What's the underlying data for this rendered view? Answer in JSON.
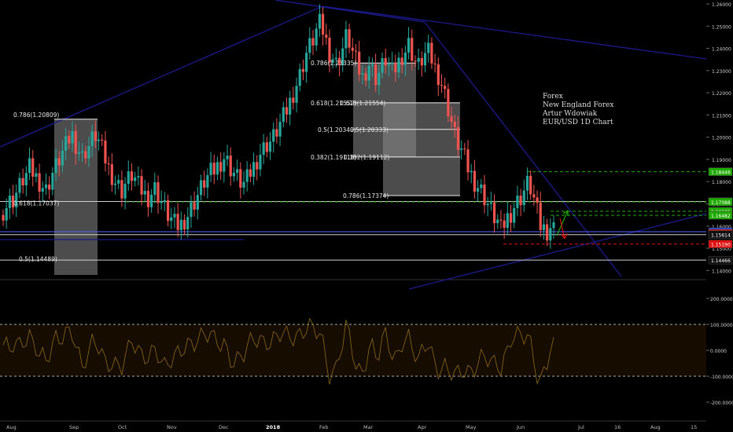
{
  "chart_data": {
    "type": "candlestick",
    "symbol": "EUR/USD",
    "timeframe": "1D",
    "price_axis": {
      "range": [
        1.138,
        1.26
      ],
      "ticks": [
        "1.26000",
        "1.25000",
        "1.24000",
        "1.23000",
        "1.22000",
        "1.21000",
        "1.20000",
        "1.19000",
        "1.18000",
        "1.17000",
        "1.16000",
        "1.15000",
        "1.14000"
      ]
    },
    "time_axis": {
      "labels": [
        "Aug",
        "Sep",
        "Oct",
        "Nov",
        "Dec",
        "2018",
        "Feb",
        "Mar",
        "Apr",
        "May",
        "Jun",
        "Jul",
        "16",
        "Aug",
        "15"
      ]
    },
    "candles_close_series": [
      1.167,
      1.169,
      1.171,
      1.172,
      1.175,
      1.178,
      1.181,
      1.183,
      1.186,
      1.184,
      1.182,
      1.18,
      1.178,
      1.176,
      1.18,
      1.184,
      1.187,
      1.19,
      1.193,
      1.196,
      1.199,
      1.201,
      1.197,
      1.194,
      1.191,
      1.194,
      1.196,
      1.199,
      1.201,
      1.198,
      1.194,
      1.19,
      1.186,
      1.183,
      1.18,
      1.178,
      1.176,
      1.179,
      1.181,
      1.183,
      1.181,
      1.178,
      1.176,
      1.174,
      1.173,
      1.175,
      1.177,
      1.174,
      1.171,
      1.168,
      1.165,
      1.163,
      1.161,
      1.16,
      1.161,
      1.163,
      1.165,
      1.168,
      1.171,
      1.174,
      1.177,
      1.18,
      1.182,
      1.184,
      1.185,
      1.187,
      1.189,
      1.191,
      1.189,
      1.186,
      1.184,
      1.182,
      1.18,
      1.179,
      1.181,
      1.184,
      1.187,
      1.19,
      1.193,
      1.195,
      1.197,
      1.198,
      1.2,
      1.203,
      1.206,
      1.209,
      1.212,
      1.216,
      1.22,
      1.224,
      1.228,
      1.233,
      1.238,
      1.241,
      1.244,
      1.248,
      1.251,
      1.248,
      1.243,
      1.238,
      1.236,
      1.233,
      1.236,
      1.24,
      1.245,
      1.243,
      1.238,
      1.234,
      1.23,
      1.227,
      1.23,
      1.233,
      1.23,
      1.227,
      1.229,
      1.232,
      1.235,
      1.232,
      1.229,
      1.231,
      1.234,
      1.237,
      1.239,
      1.242,
      1.238,
      1.234,
      1.232,
      1.235,
      1.237,
      1.238,
      1.235,
      1.231,
      1.228,
      1.224,
      1.219,
      1.213,
      1.207,
      1.201,
      1.197,
      1.194,
      1.19,
      1.186,
      1.183,
      1.18,
      1.178,
      1.176,
      1.173,
      1.17,
      1.167,
      1.164,
      1.162,
      1.158,
      1.161,
      1.164,
      1.166,
      1.169,
      1.171,
      1.173,
      1.176,
      1.179,
      1.177,
      1.172,
      1.166,
      1.16,
      1.159,
      1.158,
      1.16,
      1.159
    ],
    "rsi_like_oscillator": {
      "ticks": [
        "200.0000",
        "100.0000",
        "0.0000",
        "-100.0000",
        "-200.0000"
      ],
      "levels": [
        100,
        -100
      ]
    },
    "annotations": {
      "info_block": [
        "Forex",
        "New England Forex",
        "Artur Wdowiak",
        "EUR/USD 1D Chart"
      ],
      "fib_labels": [
        {
          "text": "0.786(1.20809)"
        },
        {
          "text": "0.618(1.17037)"
        },
        {
          "text": "0.5(1.14489)"
        },
        {
          "text": "0.786(1.23335)"
        },
        {
          "text": "0.618(1.21552)"
        },
        {
          "text": "0.618(1.21554)"
        },
        {
          "text": "0.5(1.20349)"
        },
        {
          "text": "0.5(1.20333)"
        },
        {
          "text": "0.382(1.19118)"
        },
        {
          "text": "0.382(1.19112)"
        },
        {
          "text": "0.786(1.17374)"
        }
      ],
      "price_tags": [
        {
          "text": "1.18446",
          "color": "#1faa00"
        },
        {
          "text": "1.17106",
          "color": "#111111"
        },
        {
          "text": "1.17088",
          "color": "#1faa00"
        },
        {
          "text": "1.16665",
          "color": "#1faa00"
        },
        {
          "text": "1.16482",
          "color": "#1faa00"
        },
        {
          "text": "1.15747",
          "color": "#2b4bd6"
        },
        {
          "text": "1.15672",
          "color": "#e01010"
        },
        {
          "text": "1.15614",
          "color": "#111111"
        },
        {
          "text": "1.15190",
          "color": "#e01010"
        },
        {
          "text": "1.14466",
          "color": "#111111"
        }
      ]
    },
    "colors": {
      "background": "#000000",
      "bull": "#26a69a",
      "bear": "#ef5350",
      "trendline": "#1a1a8c",
      "oscillator": "#8a6a1a",
      "fib_white": "#dddddd",
      "green_dash": "#1faa00",
      "red_dash": "#e01010"
    }
  }
}
